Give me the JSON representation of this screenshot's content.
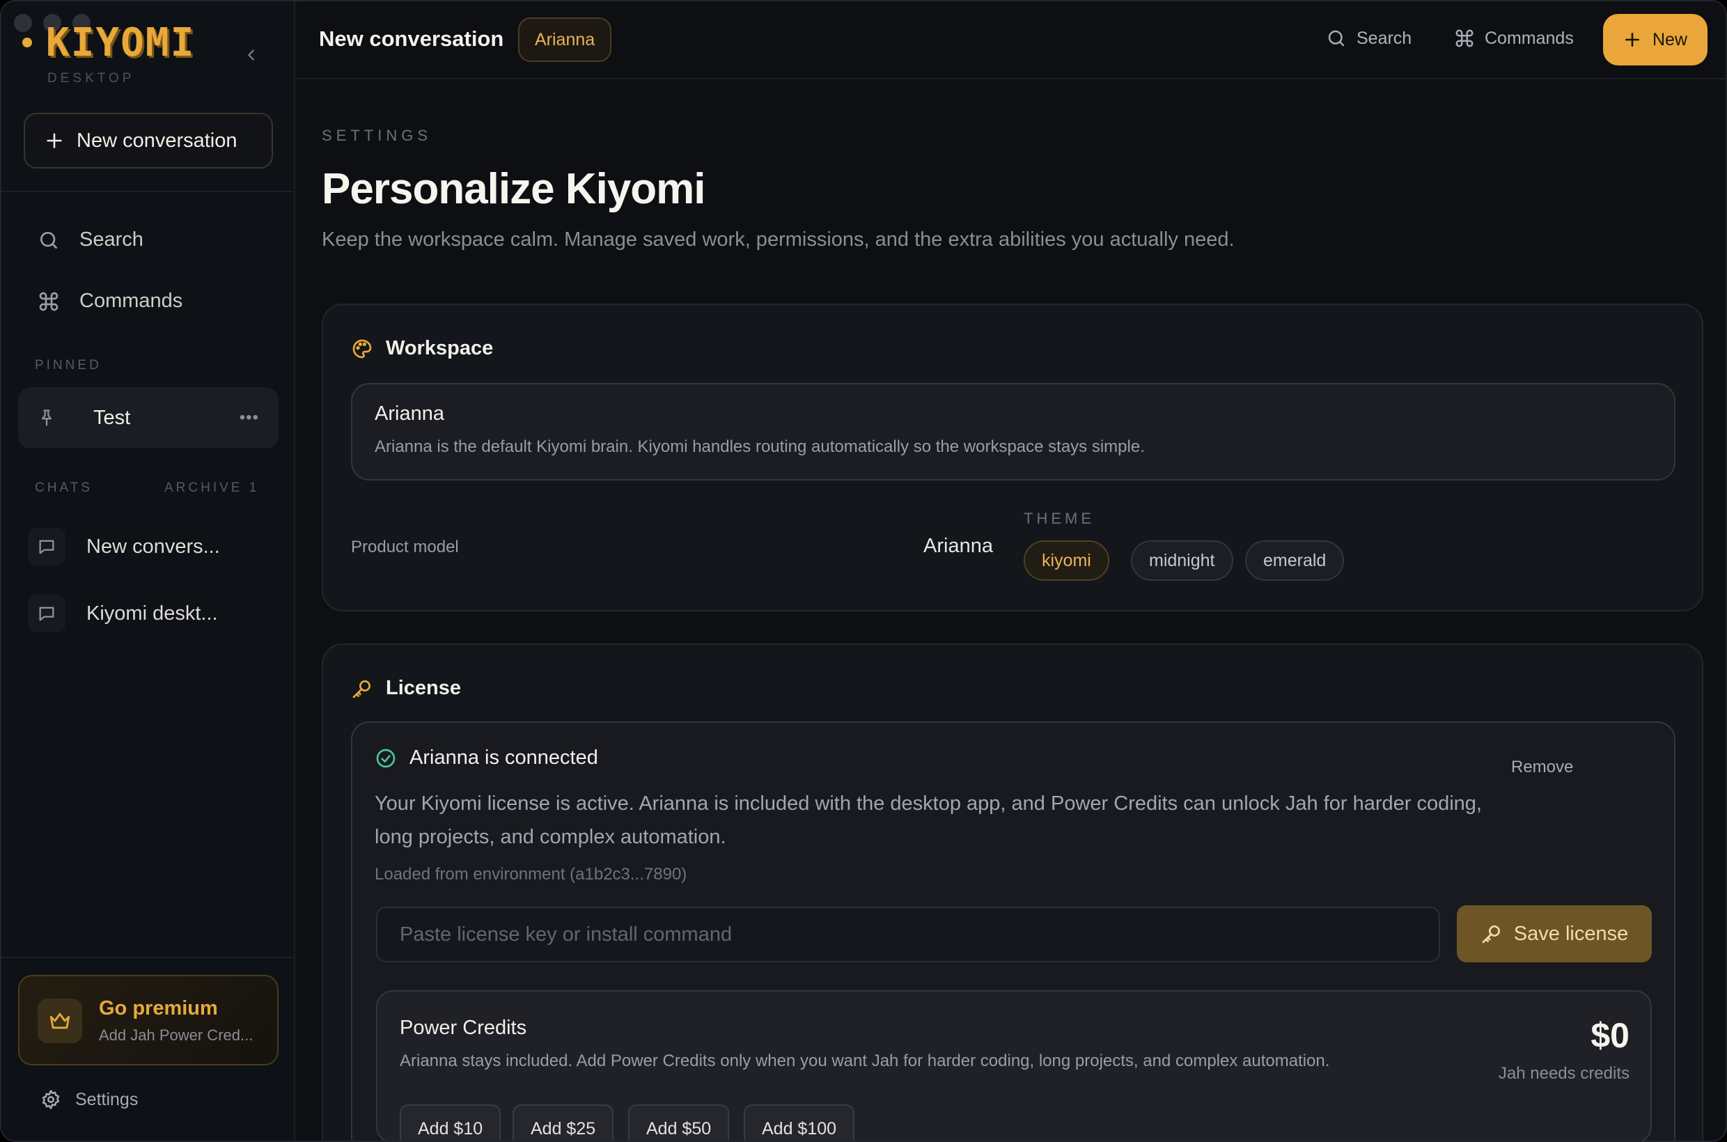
{
  "app": {
    "logo_text": "KIYOMI",
    "logo_sub": "DESKTOP",
    "accent_color": "#eaa63a"
  },
  "sidebar": {
    "new_conversation_label": "New conversation",
    "nav": [
      {
        "label": "Search",
        "icon": "search-icon"
      },
      {
        "label": "Commands",
        "icon": "command-icon"
      }
    ],
    "pinned_label": "PINNED",
    "pinned_items": [
      {
        "label": "Test",
        "icon": "pin-icon"
      }
    ],
    "chats_label": "CHATS",
    "archive_label": "ARCHIVE 1",
    "chats": [
      {
        "label": "New convers..."
      },
      {
        "label": "Kiyomi deskt..."
      }
    ],
    "premium": {
      "title": "Go premium",
      "subtitle": "Add Jah Power Cred..."
    },
    "settings_label": "Settings"
  },
  "header": {
    "title": "New conversation",
    "model_pill": "Arianna",
    "search_label": "Search",
    "commands_label": "Commands",
    "new_label": "New"
  },
  "page": {
    "eyebrow": "SETTINGS",
    "title": "Personalize Kiyomi",
    "subtitle": "Keep the workspace calm. Manage saved work, permissions, and the extra abilities you actually need."
  },
  "workspace": {
    "heading": "Workspace",
    "model_name": "Arianna",
    "model_desc": "Arianna is the default Kiyomi brain. Kiyomi handles routing automatically so the workspace stays simple.",
    "product_model_label": "Product model",
    "product_model_value": "Arianna",
    "theme_label": "THEME",
    "themes": [
      "kiyomi",
      "midnight",
      "emerald"
    ],
    "active_theme": "kiyomi"
  },
  "license": {
    "heading": "License",
    "status_title": "Arianna is connected",
    "remove_label": "Remove",
    "desc_line1": "Your Kiyomi license is active. Arianna is included with the desktop app, and Power Credits can unlock Jah for harder coding,",
    "desc_line2": "long projects, and complex automation.",
    "source": "Loaded from environment (a1b2c3...7890)",
    "input_placeholder": "Paste license key or install command",
    "save_label": "Save license",
    "credits": {
      "title": "Power Credits",
      "desc": "Arianna stays included. Add Power Credits only when you want Jah for harder coding, long projects, and complex automation.",
      "amount": "$0",
      "status": "Jah needs credits",
      "buttons": [
        "Add $10",
        "Add $25",
        "Add $50",
        "Add $100"
      ]
    }
  }
}
